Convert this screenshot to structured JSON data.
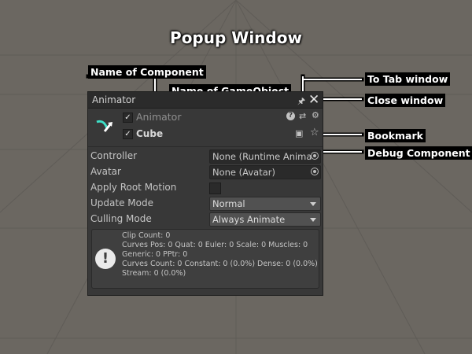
{
  "page_title": "Popup Window",
  "callouts": {
    "name_of_component": "Name of Component",
    "name_of_gameobject": "Name of GameObject",
    "to_tab_window": "To Tab window",
    "close_window": "Close window",
    "bookmark": "Bookmark",
    "debug_component": "Debug Component"
  },
  "window": {
    "title": "Animator",
    "pin_glyph": "🖈",
    "close_glyph": "✕"
  },
  "header": {
    "component_name": "Animator",
    "component_enabled_check": "✓",
    "gameobject_name": "Cube",
    "gameobject_active_check": "✓",
    "help_glyph": "?",
    "preset_glyph": "⇄",
    "settings_glyph": "⚙",
    "debug_glyph": "▣",
    "bookmark_glyph": "☆"
  },
  "properties": [
    {
      "label": "Controller",
      "value": "None (Runtime Anima"
    },
    {
      "label": "Avatar",
      "value": "None (Avatar)"
    },
    {
      "label": "Apply Root Motion"
    },
    {
      "label": "Update Mode",
      "value": "Normal"
    },
    {
      "label": "Culling Mode",
      "value": "Always Animate"
    }
  ],
  "info": {
    "icon_glyph": "!",
    "lines": [
      "Clip Count: 0",
      "Curves Pos: 0 Quat: 0 Euler: 0 Scale: 0 Muscles: 0",
      "Generic: 0 PPtr: 0",
      "Curves Count: 0 Constant: 0 (0.0%) Dense: 0 (0.0%)",
      "Stream: 0 (0.0%)"
    ]
  },
  "colors": {
    "accent_teal": "#3ee0c8",
    "panel_bg": "#383838"
  }
}
